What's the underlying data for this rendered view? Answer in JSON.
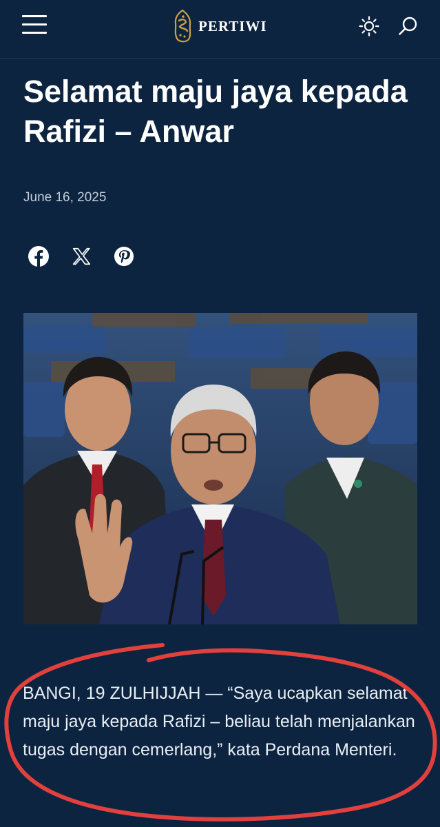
{
  "header": {
    "brand": "PERTIWI",
    "menu_icon": "hamburger-menu-icon",
    "theme_icon": "sun-icon",
    "search_icon": "search-icon"
  },
  "article": {
    "title": "Selamat maju jaya kepada Rafizi – Anwar",
    "date": "June 16, 2025",
    "share": [
      {
        "network": "facebook",
        "icon": "facebook-icon"
      },
      {
        "network": "x",
        "icon": "x-icon"
      },
      {
        "network": "pinterest",
        "icon": "pinterest-icon"
      }
    ],
    "lead": "BANGI, 19 ZULHIJJAH — “Saya ucapkan selamat maju jaya kepada Rafizi – beliau telah menjalankan tugas dengan cemerlang,” kata Perdana Menteri."
  },
  "colors": {
    "background": "#0c2440",
    "text": "#ffffff",
    "muted_text": "#c5cfdb",
    "annotation_circle": "#e2403c",
    "logo_gold": "#c9a24a"
  }
}
